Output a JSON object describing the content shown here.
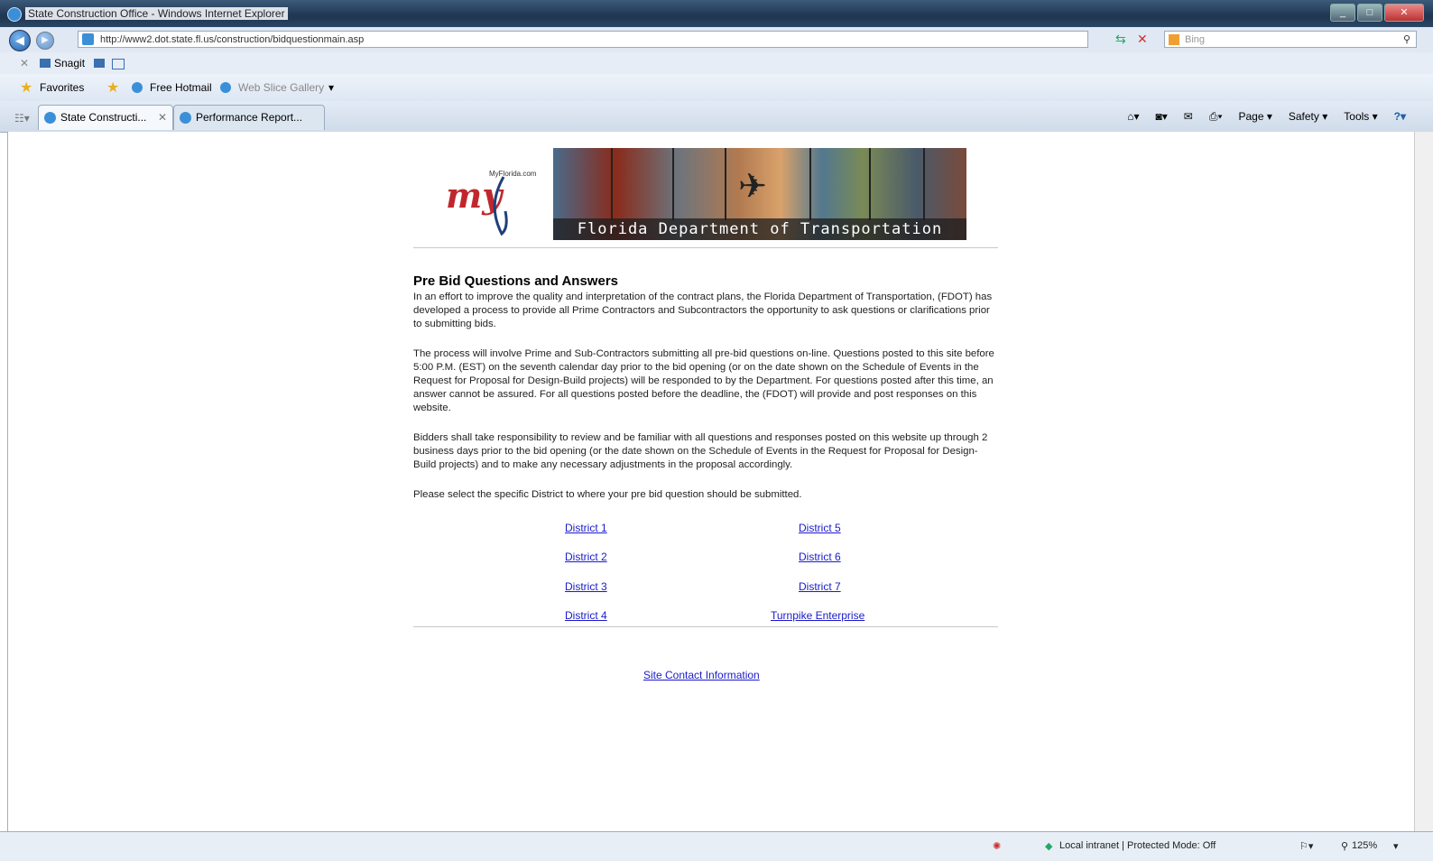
{
  "window": {
    "title": "State Construction Office - Windows Internet Explorer"
  },
  "address_bar": {
    "url": "http://www2.dot.state.fl.us/construction/bidquestionmain.asp",
    "search_placeholder": "Bing"
  },
  "snagit_bar": {
    "label": "Snagit"
  },
  "favorites_bar": {
    "favorites_label": "Favorites",
    "items": [
      "Free Hotmail",
      "Web Slice Gallery"
    ]
  },
  "tabs": [
    {
      "label": "State Constructi..."
    },
    {
      "label": "Performance Report..."
    }
  ],
  "command_bar": {
    "page": "Page",
    "safety": "Safety",
    "tools": "Tools"
  },
  "banner": {
    "logo_text": "my",
    "logo_site": "MyFlorida.com",
    "caption": "Florida Department of Transportation"
  },
  "page": {
    "heading": "Pre Bid Questions and Answers",
    "paragraphs": [
      "In an effort to improve the quality and interpretation of the contract plans, the Florida Department of Transportation, (FDOT) has developed a process to provide all Prime Contractors and Subcontractors the opportunity to ask questions or clarifications prior to submitting bids.",
      "The process will involve Prime and Sub-Contractors submitting all pre-bid questions on-line. Questions posted to this site before 5:00 P.M. (EST) on the seventh calendar day prior to the bid opening (or on the date shown on the Schedule of Events in the Request for Proposal for Design-Build projects) will be responded to by the Department. For questions posted after this time, an answer cannot be assured. For all questions posted before the deadline, the (FDOT) will provide and post responses on this website.",
      "Bidders shall take responsibility to review and be familiar with all questions and responses posted on this website up through 2 business days prior to the bid opening (or the date shown on the Schedule of Events in the Request for Proposal for Design-Build projects) and to make any necessary adjustments in the proposal accordingly.",
      "Please select the specific District to where your pre bid question should be submitted."
    ],
    "districts_left": [
      "District 1",
      "District 2",
      "District 3",
      "District 4"
    ],
    "districts_right": [
      "District 5",
      "District 6",
      "District 7",
      "Turnpike Enterprise"
    ],
    "contact_link": "Site Contact Information"
  },
  "status_bar": {
    "zone": "Local intranet | Protected Mode: Off",
    "zoom": "125%"
  }
}
